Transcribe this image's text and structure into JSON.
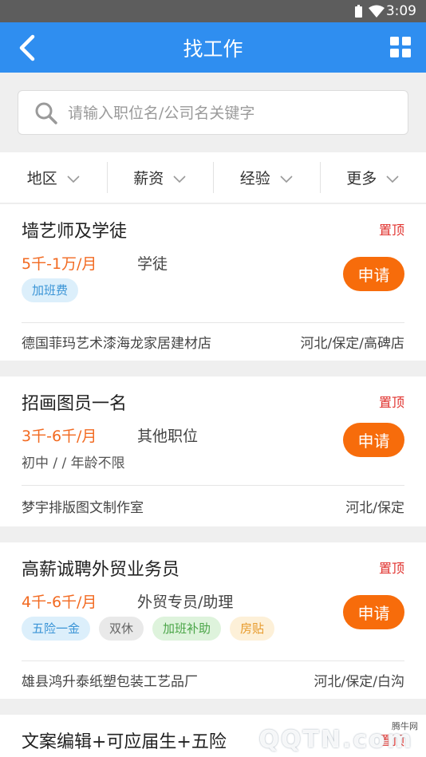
{
  "status_bar": {
    "time": "3:09"
  },
  "nav": {
    "title": "找工作"
  },
  "search": {
    "placeholder": "请输入职位名/公司名关键字",
    "value": ""
  },
  "filters": [
    {
      "label": "地区"
    },
    {
      "label": "薪资"
    },
    {
      "label": "经验"
    },
    {
      "label": "更多"
    }
  ],
  "jobs": [
    {
      "title": "墙艺师及学徒",
      "pin": "置顶",
      "salary": "5千-1万/月",
      "category": "学徒",
      "tags": [
        "加班费"
      ],
      "apply_label": "申请",
      "company": "德国菲玛艺术漆海龙家居建材店",
      "location": "河北/保定/高碑店"
    },
    {
      "title": "招画图员一名",
      "pin": "置顶",
      "salary": "3千-6千/月",
      "category": "其他职位",
      "requirements": "初中 / / 年龄不限",
      "apply_label": "申请",
      "company": "梦宇排版图文制作室",
      "location": "河北/保定"
    },
    {
      "title": "高薪诚聘外贸业务员",
      "pin": "置顶",
      "salary": "4千-6千/月",
      "category": "外贸专员/助理",
      "tags": [
        "五险一金",
        "双休",
        "加班补助",
        "房贴"
      ],
      "apply_label": "申请",
      "company": "雄县鸿升泰纸塑包装工艺品厂",
      "location": "河北/保定/白沟"
    },
    {
      "title": "文案编辑+可应届生+五险",
      "pin": "置顶"
    }
  ],
  "watermark": {
    "site": "腾牛网",
    "logo": "QQTN.com"
  },
  "colors": {
    "nav_blue": "#2f8ef0",
    "accent_orange": "#f76c0b",
    "salary_orange": "#f26a21",
    "pin_red": "#e0312d"
  }
}
